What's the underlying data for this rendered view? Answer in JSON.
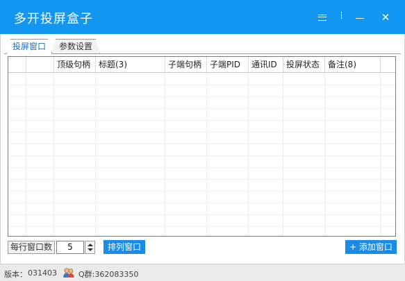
{
  "window": {
    "title": "多开投屏盒子",
    "controls": {
      "menu": "menu-icon",
      "divider": "divider-icon",
      "minimize": "minimize-icon",
      "close": "close-icon"
    }
  },
  "tabs": [
    {
      "label": "投屏窗口",
      "active": true
    },
    {
      "label": "参数设置",
      "active": false
    }
  ],
  "table": {
    "columns": [
      "",
      "",
      "顶级句柄",
      "标题(3)",
      "子端句柄",
      "子端PID",
      "通讯ID",
      "投屏状态",
      "备注(8)",
      ""
    ],
    "rows": []
  },
  "bottom": {
    "per_row_label": "每行窗口数",
    "per_row_value": "5",
    "arrange_label": "排列窗口",
    "add_label": "+ 添加窗口"
  },
  "status": {
    "version_label": "版本：",
    "version_value": "031403",
    "qq_group": "Q群:362083350"
  },
  "colors": {
    "title_bar": "#1296ef",
    "button": "#1a8be8",
    "active_tab_text": "#1a6bc4"
  }
}
